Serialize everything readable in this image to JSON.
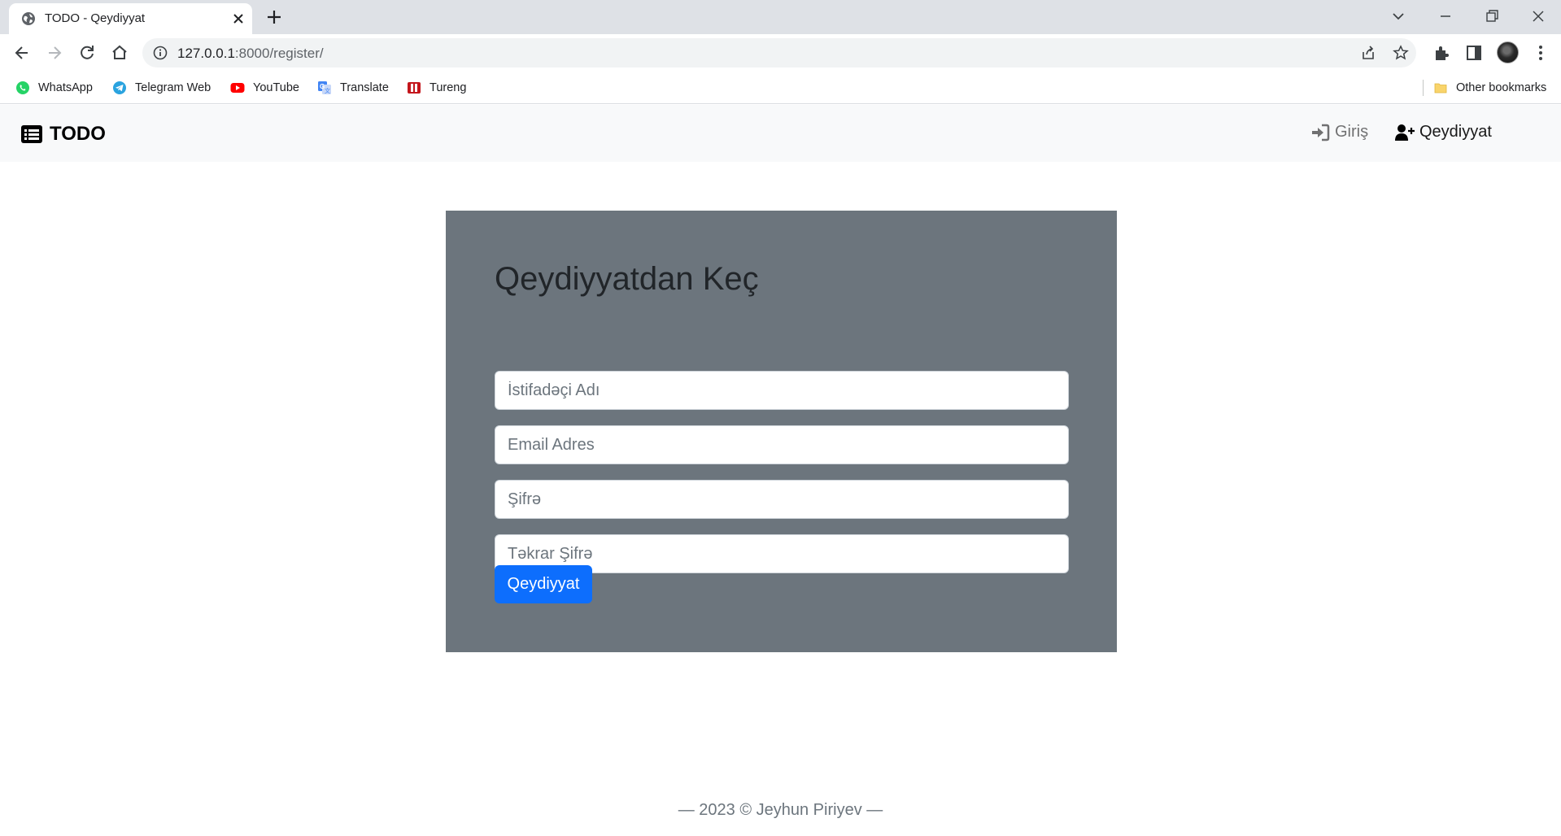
{
  "browser": {
    "tab_title": "TODO - Qeydiyyat",
    "url_host": "127.0.0.1",
    "url_path": ":8000/register/",
    "bookmarks": [
      {
        "label": "WhatsApp",
        "icon": "whatsapp-icon"
      },
      {
        "label": "Telegram Web",
        "icon": "telegram-icon"
      },
      {
        "label": "YouTube",
        "icon": "youtube-icon"
      },
      {
        "label": "Translate",
        "icon": "translate-icon"
      },
      {
        "label": "Tureng",
        "icon": "tureng-icon"
      }
    ],
    "other_bookmarks": "Other bookmarks"
  },
  "navbar": {
    "brand": "TODO",
    "login": "Giriş",
    "register": "Qeydiyyat"
  },
  "form": {
    "title": "Qeydiyyatdan Keç",
    "username_placeholder": "İstifadəçi Adı",
    "email_placeholder": "Email Adres",
    "password_placeholder": "Şifrə",
    "password_repeat_placeholder": "Təkrar Şifrə",
    "submit": "Qeydiyyat"
  },
  "footer": {
    "text": "— 2023 © Jeyhun Piriyev —"
  },
  "colors": {
    "card": "#6c757d",
    "primary": "#0d6efd",
    "navbar": "#f8f9fa"
  }
}
